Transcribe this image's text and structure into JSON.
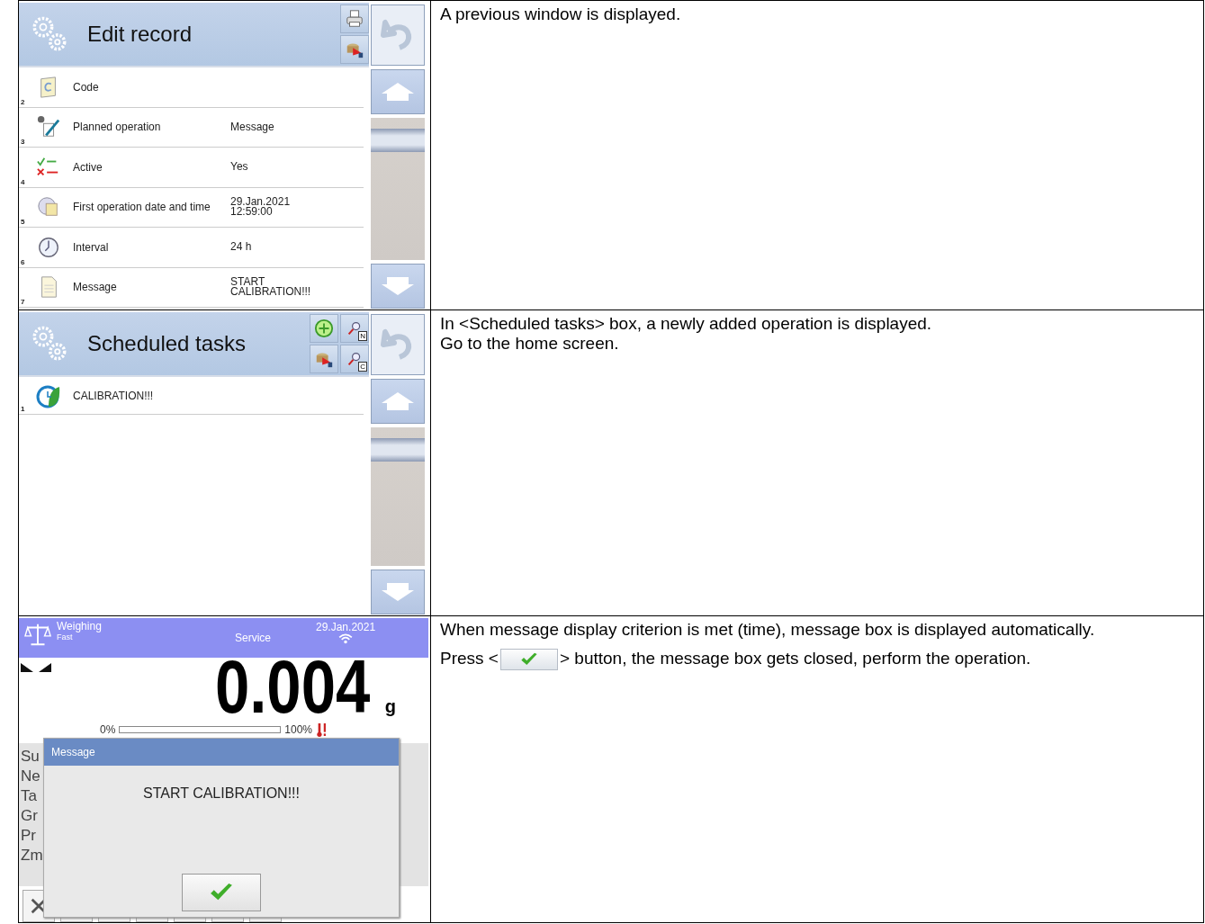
{
  "edit_record_screen": {
    "title": "Edit record",
    "header_buttons": [
      {
        "kind": "print"
      },
      {
        "kind": "database"
      }
    ],
    "items": [
      {
        "index": "2",
        "kind": "code",
        "label": "Code"
      },
      {
        "index": "3",
        "kind": "operation",
        "label": "Planned operation",
        "value": "Message"
      },
      {
        "index": "4",
        "kind": "active",
        "label": "Active",
        "value": "Yes"
      },
      {
        "index": "5",
        "kind": "datetime",
        "label": "First operation date and time",
        "value": "29.Jan.2021\n12:59:00"
      },
      {
        "index": "6",
        "kind": "interval",
        "label": "Interval",
        "value": "24 h"
      },
      {
        "index": "7",
        "kind": "message",
        "label": "Message",
        "value": "START\nCALIBRATION!!!"
      }
    ]
  },
  "edit_record_description": "A previous window is displayed.",
  "scheduled_tasks_screen": {
    "title": "Scheduled tasks",
    "header_buttons": [
      {
        "kind": "add"
      },
      {
        "kind": "search",
        "badge": "N"
      },
      {
        "kind": "database"
      },
      {
        "kind": "search",
        "badge": "C"
      }
    ],
    "items": [
      {
        "index": "1",
        "label": "CALIBRATION!!!"
      }
    ]
  },
  "scheduled_tasks_description": [
    "In <Scheduled tasks> box, a newly added operation is displayed.",
    "Go to the home screen."
  ],
  "weighing_screen": {
    "mode": "Weighing",
    "submode": "Fast",
    "user": "Service",
    "date": "29.Jan.2021",
    "reading": "0.004",
    "unit": "g",
    "bar": {
      "min_label": "0%",
      "max_label": "100%"
    },
    "info_labels": [
      "Su",
      "Ne",
      "Ta",
      "Gr",
      "Pr",
      "Zm"
    ],
    "dialog": {
      "title": "Message",
      "text": "START CALIBRATION!!!"
    }
  },
  "weighing_description": {
    "first": "When message display criterion is met (time), message box is displayed automatically.",
    "press_before": "Press <",
    "press_after": "> button, the message box gets closed, perform the operation."
  }
}
